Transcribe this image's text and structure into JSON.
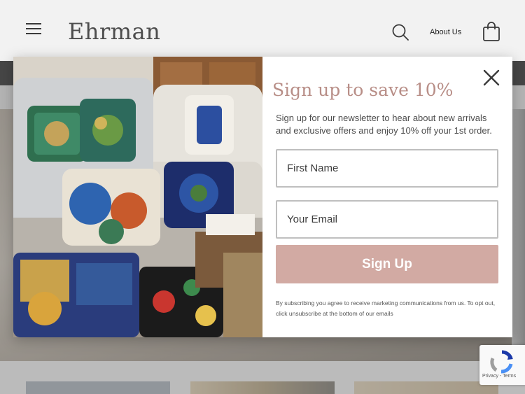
{
  "header": {
    "logo": "Ehrman",
    "about_label": "About Us",
    "icons": {
      "menu": "hamburger-menu-icon",
      "search": "search-icon",
      "cart": "shopping-bag-icon"
    }
  },
  "modal": {
    "image_alt": "needlepoint-cushions-on-sofa-photo",
    "title": "Sign up to save 10%",
    "description": "Sign up for our newsletter to hear about new arrivals and exclusive offers and enjoy 10% off your 1st order.",
    "first_name_placeholder": "First Name",
    "email_placeholder": "Your Email",
    "signup_label": "Sign Up",
    "disclaimer": "By subscribing you agree to receive marketing communications from us. To opt out, click unsubscribe at the bottom of our emails",
    "close_icon": "close-icon"
  },
  "recaptcha": {
    "privacy": "Privacy",
    "separator": " - ",
    "terms": "Terms"
  },
  "colors": {
    "accent": "#b88e87",
    "button": "#d2aaa3",
    "header_bg": "#f2f2f2",
    "text": "#4d4d4d"
  }
}
